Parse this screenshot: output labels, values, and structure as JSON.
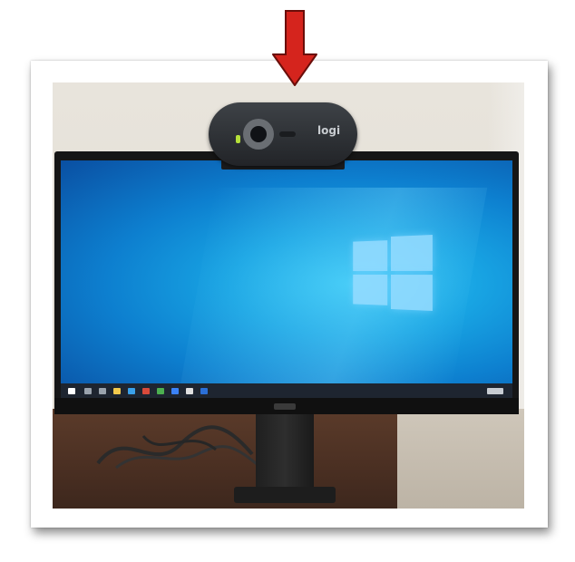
{
  "image": {
    "description_free": true,
    "webcam": {
      "logo_text": "logi"
    },
    "colors": {
      "arrow": "#d5241d",
      "arrow_outline": "#6a0e0a",
      "screen_center": "#33c6f4",
      "screen_edge": "#0a4fa2",
      "frame": "#ffffff"
    },
    "icons": [
      "down-arrow-icon",
      "windows-logo-icon"
    ]
  }
}
